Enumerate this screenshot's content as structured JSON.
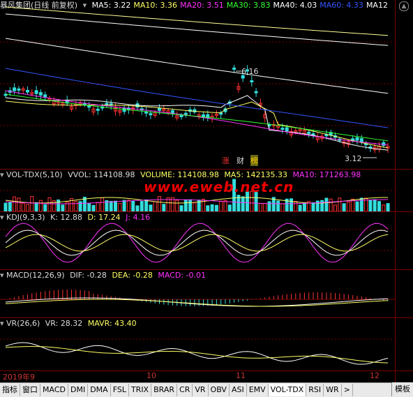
{
  "main": {
    "title": "暴风集团(日线 前复权)",
    "ma": [
      {
        "label": "MA5: 3.22",
        "color": "#ffffff"
      },
      {
        "label": "MA10: 3.36",
        "color": "#ffff66"
      },
      {
        "label": "MA20: 3.51",
        "color": "#ff33ff"
      },
      {
        "label": "MA30: 3.83",
        "color": "#33ff33"
      },
      {
        "label": "MA40: 4.03",
        "color": "#ffffff"
      },
      {
        "label": "MA60: 4.33",
        "color": "#3355ff"
      },
      {
        "label": "MA12",
        "color": "#ffffff"
      }
    ],
    "high_label": "6.16",
    "low_label": "3.12",
    "tags": [
      "涨",
      "财",
      "榜"
    ]
  },
  "vol": {
    "title": "VOL-TDX(5,10)",
    "vvol": "VVOL: 114108.98",
    "volume": "VOLUME: 114108.98",
    "ma5": "MA5: 142135.33",
    "ma10": "MA10: 171263.98"
  },
  "kdj": {
    "title": "KDJ(9,3,3)",
    "k": "K: 12.88",
    "d": "D: 17.24",
    "j": "J: 4.16"
  },
  "macd": {
    "title": "MACD(12,26,9)",
    "dif": "DIF: -0.28",
    "dea": "DEA: -0.28",
    "macd": "MACD: -0.01"
  },
  "vr": {
    "title": "VR(26,6)",
    "vr": "VR: 28.32",
    "mavr": "MAVR: 43.40"
  },
  "dates": [
    "2019年9",
    "10",
    "11",
    "12"
  ],
  "watermark": "www.eweb.net.cn",
  "tabs": [
    "指标",
    "窗口",
    "MACD",
    "DMI",
    "DMA",
    "FSL",
    "TRIX",
    "BRAR",
    "CR",
    "VR",
    "OBV",
    "ASI",
    "EMV",
    "VOL-TDX",
    "RSI",
    "WR"
  ],
  "more": ">",
  "template_btn": "模板",
  "colors": {
    "bg": "#000000",
    "up": "#ff3333",
    "down": "#33dddd",
    "grid": "#7a0000"
  }
}
